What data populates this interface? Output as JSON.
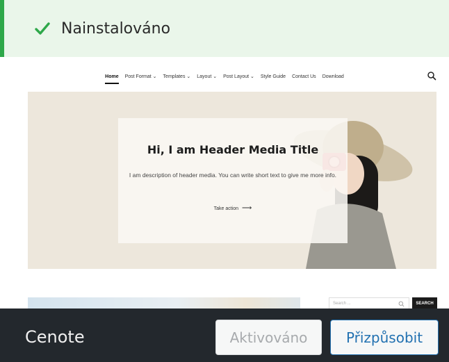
{
  "notice": {
    "message": "Nainstalováno",
    "icon": "checkmark-icon",
    "accent_color": "#2ea84a"
  },
  "preview": {
    "nav": {
      "items": [
        "Home",
        "Post Format ⌄",
        "Templates ⌄",
        "Layout ⌄",
        "Post Layout ⌄",
        "Style Guide",
        "Contact Us",
        "Download"
      ],
      "search_icon": "search-icon"
    },
    "hero": {
      "title": "Hi, I am Header Media Title",
      "description": "I am description of header media. You can write short text to give me more info.",
      "action_label": "Take action",
      "action_arrow": "⟶"
    },
    "sidebar": {
      "search_placeholder": "Search ...",
      "search_button": "SEARCH"
    }
  },
  "footer": {
    "theme_name": "Cenote",
    "activated_label": "Aktivováno",
    "customize_label": "Přizpůsobit",
    "customize_color": "#2271b1"
  }
}
